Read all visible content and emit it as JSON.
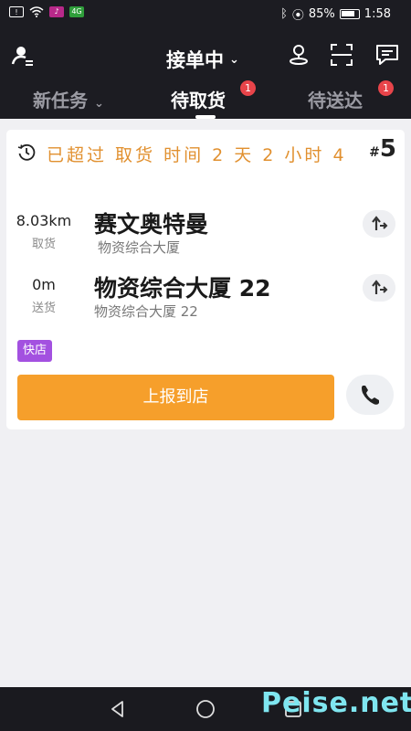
{
  "status_bar": {
    "battery": "85%",
    "time": "1:58",
    "sim_badge": "!",
    "app_badge": "4G"
  },
  "header": {
    "mode_label": "接单中",
    "mode_chevron": "⌄"
  },
  "tabs": [
    {
      "label": "新任务",
      "chevron": "⌄"
    },
    {
      "label": "待取货",
      "badge": "1"
    },
    {
      "label": "待送达",
      "badge": "1"
    }
  ],
  "order": {
    "warning": "已超过 取货 时间 2 天 2 小时 4",
    "number_hash": "#",
    "number": "5",
    "pickup": {
      "distance": "8.03km",
      "label": "取货",
      "name": "赛文奥特曼",
      "address": "物资综合大厦"
    },
    "delivery": {
      "distance": "0m",
      "label": "送货",
      "name": "物资综合大厦 22",
      "address": "物资综合大厦 22"
    },
    "tag": "快店",
    "report_button": "上报到店"
  },
  "watermark": "Peise.net",
  "colors": {
    "accent": "#f69f2b",
    "warning": "#e1902f",
    "tag": "#a351e0",
    "badge": "#e8444a",
    "header": "#1c1c22"
  }
}
